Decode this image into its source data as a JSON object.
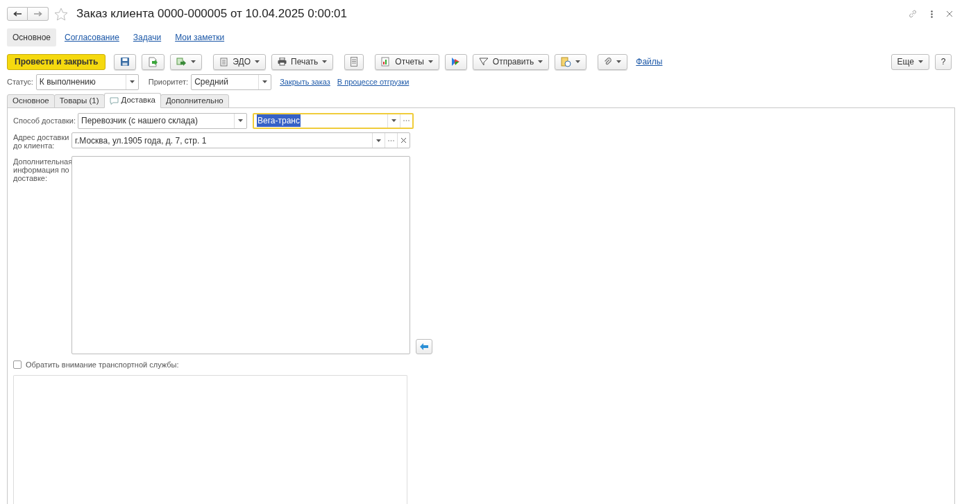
{
  "window": {
    "title": "Заказ клиента 0000-000005 от 10.04.2025 0:00:01",
    "favorite": false
  },
  "nav": [
    {
      "label": "Основное",
      "selected": true
    },
    {
      "label": "Согласование",
      "selected": false
    },
    {
      "label": "Задачи",
      "selected": false
    },
    {
      "label": "Мои заметки",
      "selected": false
    }
  ],
  "toolbar": {
    "primary": "Провести и закрыть",
    "buttons": [
      {
        "kind": "icon"
      },
      {
        "kind": "icon"
      },
      {
        "kind": "icon_menu"
      },
      {
        "kind": "text_menu",
        "label": "ЭДО"
      },
      {
        "kind": "text_menu",
        "label": "Печать"
      },
      {
        "kind": "icon"
      },
      {
        "kind": "text_menu",
        "label": "Отчеты"
      },
      {
        "kind": "icon"
      },
      {
        "kind": "text_menu",
        "label": "Отправить"
      },
      {
        "kind": "icon_menu"
      },
      {
        "kind": "icon_menu"
      },
      {
        "kind": "link",
        "label": "Файлы"
      }
    ],
    "more": "Еще",
    "help": "?"
  },
  "status_row": {
    "status_label": "Статус:",
    "status": "К выполнению",
    "priority_label": "Приоритет:",
    "priority": "Средний",
    "links": [
      "Закрыть заказ",
      "В процессе отгрузки"
    ]
  },
  "tabs": [
    {
      "label": "Основное",
      "selected": false,
      "icon": false
    },
    {
      "label": "Товары (1)",
      "selected": false,
      "icon": false
    },
    {
      "label": "Доставка",
      "selected": true,
      "icon": true
    },
    {
      "label": "Дополнительно",
      "selected": false,
      "icon": false
    }
  ],
  "delivery": {
    "method_label": "Способ доставки:",
    "method": "Перевозчик (с нашего склада)",
    "carrier": "Вега-транс",
    "carrier_focused": true,
    "address_label": "Адрес доставки до клиента:",
    "address": "г.Москва, ул.1905 года, д. 7, стр. 1",
    "info_label": "Дополнительная информация по доставке:",
    "attention_label": "Обратить внимание транспортной службы:",
    "attention_checked": false
  }
}
